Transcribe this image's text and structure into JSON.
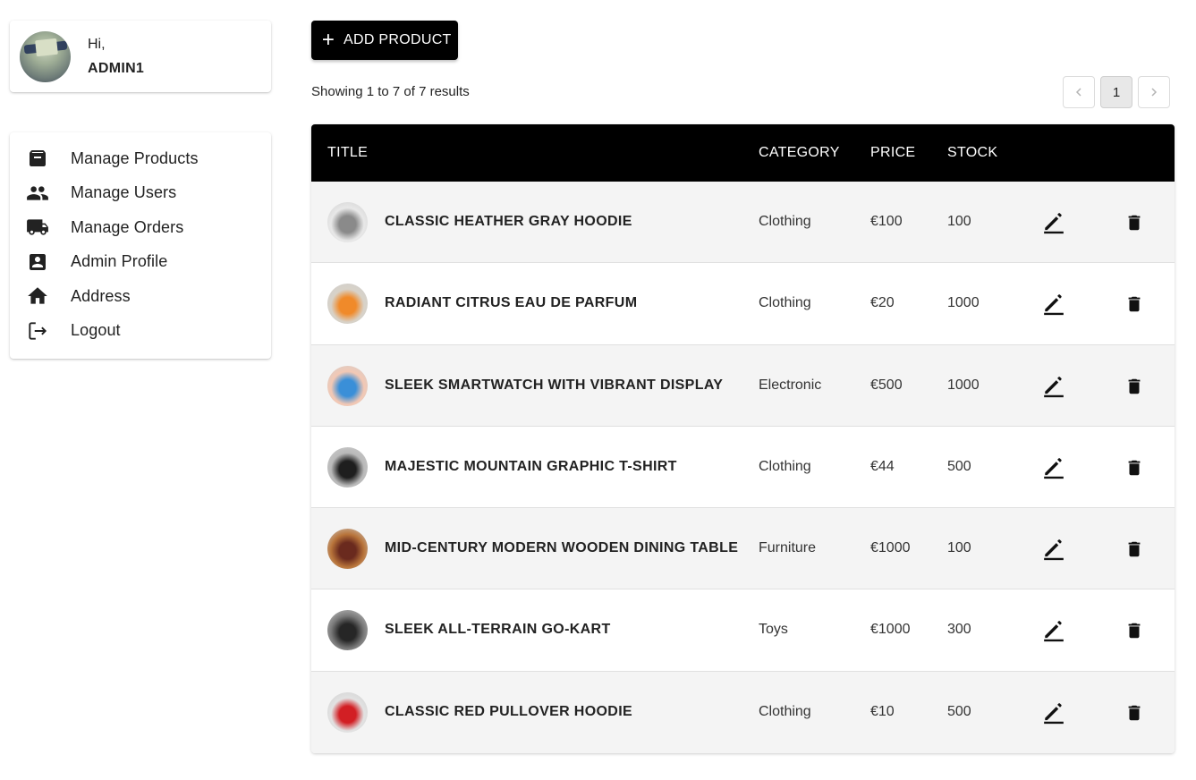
{
  "profile": {
    "greeting": "Hi,",
    "username": "ADMIN1"
  },
  "menu": [
    {
      "label": "Manage Products",
      "icon": "archive-icon"
    },
    {
      "label": "Manage Users",
      "icon": "people-icon"
    },
    {
      "label": "Manage Orders",
      "icon": "truck-icon"
    },
    {
      "label": "Admin Profile",
      "icon": "account-box-icon"
    },
    {
      "label": "Address",
      "icon": "home-icon"
    },
    {
      "label": "Logout",
      "icon": "logout-icon"
    }
  ],
  "toolbar": {
    "add_label": "ADD PRODUCT"
  },
  "results_text": "Showing 1 to 7 of 7 results",
  "pagination": {
    "prev": "‹",
    "current": "1",
    "next": "›"
  },
  "table": {
    "headers": {
      "title": "TITLE",
      "category": "CATEGORY",
      "price": "PRICE",
      "stock": "STOCK"
    },
    "rows": [
      {
        "title": "CLASSIC HEATHER GRAY HOODIE",
        "category": "Clothing",
        "price": "€100",
        "stock": "100",
        "thumb_colors": [
          "#e8e8e8",
          "#8a8a8a"
        ]
      },
      {
        "title": "RADIANT CITRUS EAU DE PARFUM",
        "category": "Clothing",
        "price": "€20",
        "stock": "1000",
        "thumb_colors": [
          "#d8d2c8",
          "#f08a2a"
        ]
      },
      {
        "title": "SLEEK SMARTWATCH WITH VIBRANT DISPLAY",
        "category": "Electronic",
        "price": "€500",
        "stock": "1000",
        "thumb_colors": [
          "#f3c8b4",
          "#3a8fd8"
        ]
      },
      {
        "title": "MAJESTIC MOUNTAIN GRAPHIC T-SHIRT",
        "category": "Clothing",
        "price": "€44",
        "stock": "500",
        "thumb_colors": [
          "#b9b9b9",
          "#1e1e1e"
        ]
      },
      {
        "title": "MID-CENTURY MODERN WOODEN DINING TABLE",
        "category": "Furniture",
        "price": "€1000",
        "stock": "100",
        "thumb_colors": [
          "#b8743a",
          "#6a2a1e"
        ]
      },
      {
        "title": "SLEEK ALL-TERRAIN GO-KART",
        "category": "Toys",
        "price": "€1000",
        "stock": "300",
        "thumb_colors": [
          "#7a7a7a",
          "#262626"
        ]
      },
      {
        "title": "CLASSIC RED PULLOVER HOODIE",
        "category": "Clothing",
        "price": "€10",
        "stock": "500",
        "thumb_colors": [
          "#e2e2e2",
          "#d21f24"
        ]
      }
    ]
  }
}
